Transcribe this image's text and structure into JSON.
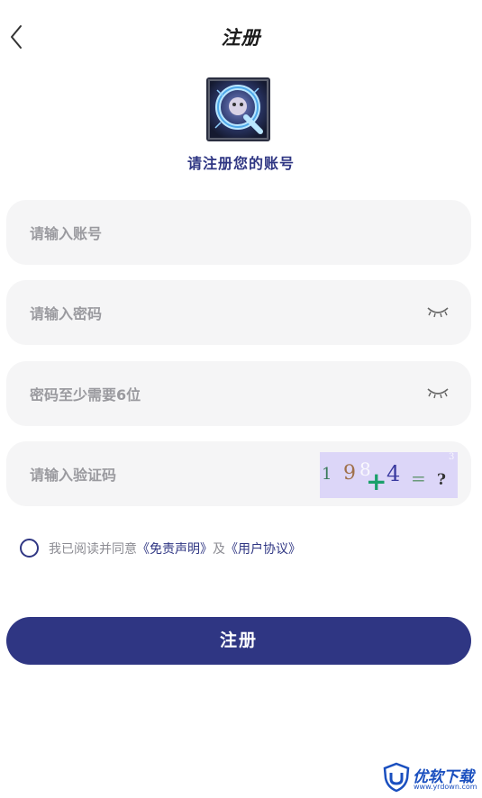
{
  "header": {
    "title": "注册"
  },
  "subtitle": "请注册您的账号",
  "fields": {
    "account": {
      "placeholder": "请输入账号",
      "value": ""
    },
    "password": {
      "placeholder": "请输入密码",
      "value": ""
    },
    "confirm": {
      "placeholder": "密码至少需要6位",
      "value": ""
    },
    "captcha": {
      "placeholder": "请输入验证码",
      "value": "",
      "image_text": "198+4",
      "image_suffix": "=?"
    }
  },
  "agreement": {
    "prefix": "我已阅读并同意",
    "disclaimer": "《免责声明》",
    "and": "及",
    "user_agreement": "《用户协议》",
    "checked": false
  },
  "submit_label": "注册",
  "watermark": {
    "text": "优软下载",
    "url": "www.yrdown.com"
  },
  "colors": {
    "primary": "#2f3683",
    "field_bg": "#f5f5f6",
    "captcha_bg": "#dcd6f8"
  }
}
